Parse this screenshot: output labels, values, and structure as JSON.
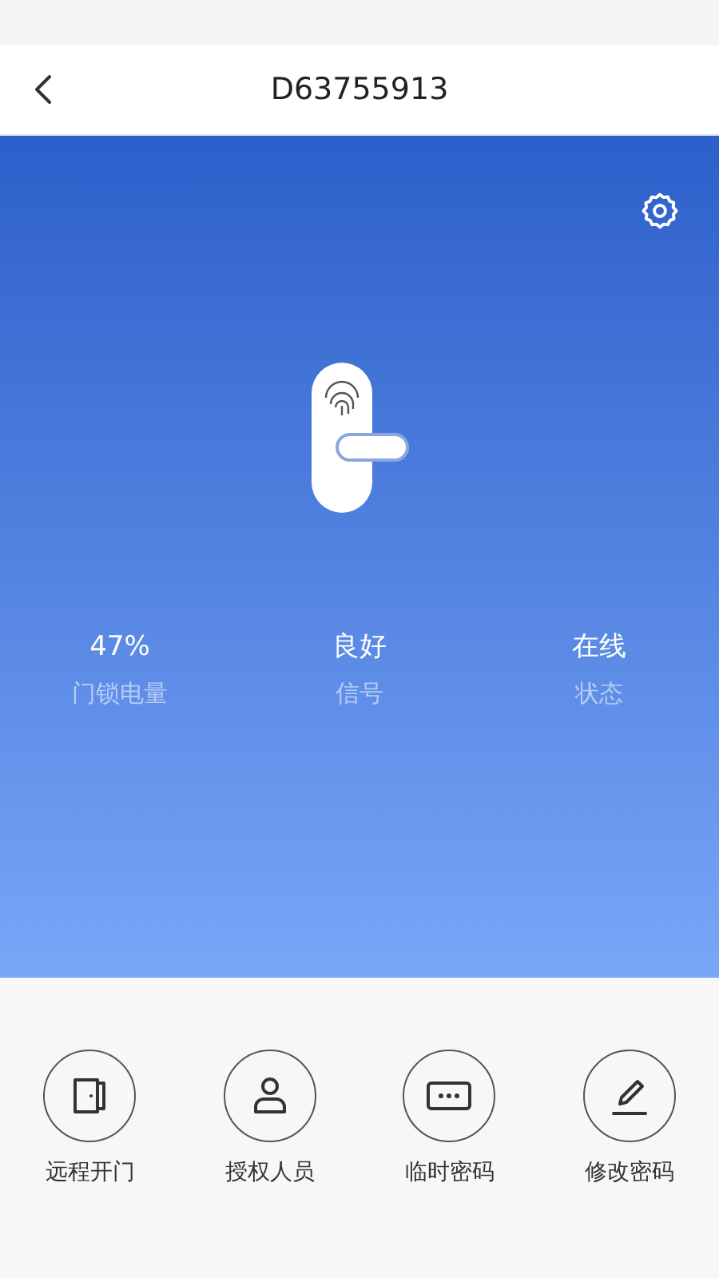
{
  "header": {
    "title": "D63755913"
  },
  "stats": [
    {
      "value": "47%",
      "label": "门锁电量"
    },
    {
      "value": "良好",
      "label": "信号"
    },
    {
      "value": "在线",
      "label": "状态"
    }
  ],
  "actions": [
    {
      "kind": "door",
      "label": "远程开门"
    },
    {
      "kind": "person",
      "label": "授权人员"
    },
    {
      "kind": "password",
      "label": "临时密码"
    },
    {
      "kind": "edit",
      "label": "修改密码"
    }
  ]
}
